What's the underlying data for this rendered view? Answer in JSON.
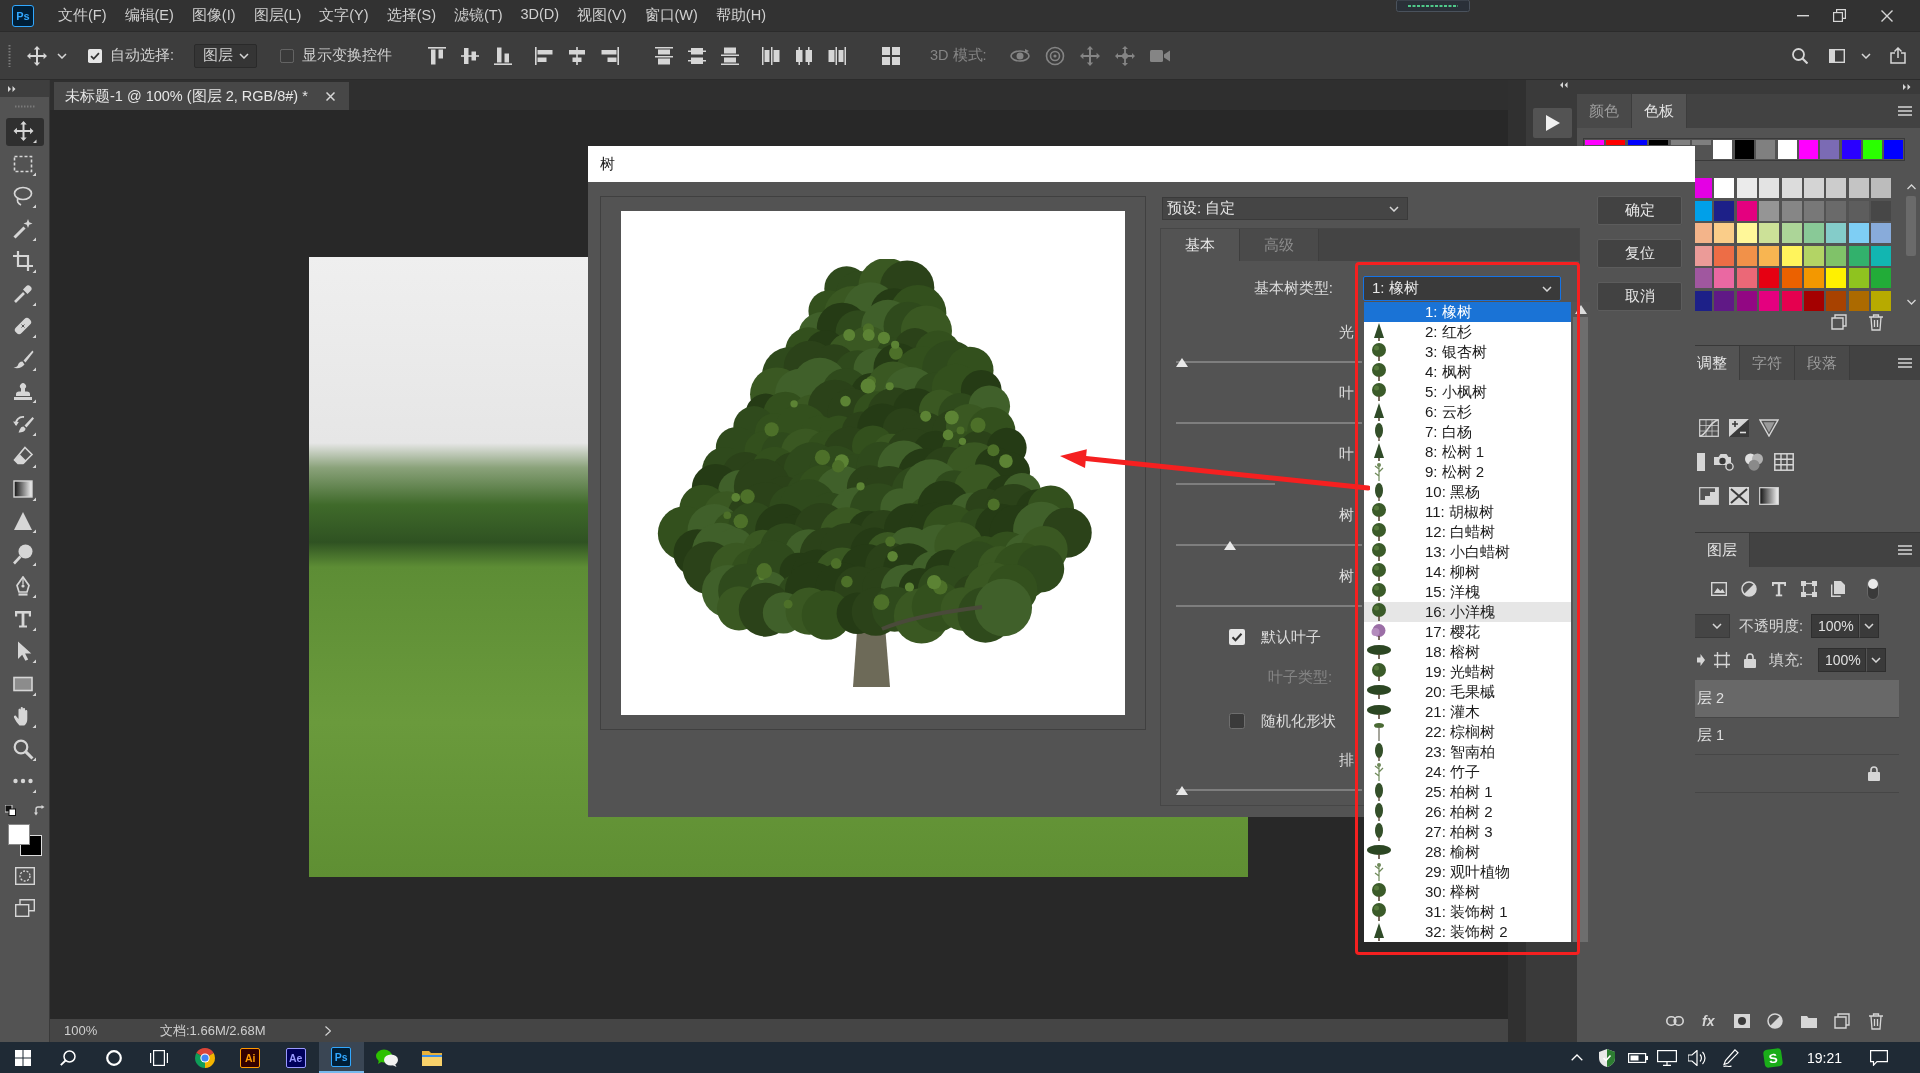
{
  "menu_bar": {
    "logo": "Ps",
    "items": [
      "文件(F)",
      "编辑(E)",
      "图像(I)",
      "图层(L)",
      "文字(Y)",
      "选择(S)",
      "滤镜(T)",
      "3D(D)",
      "视图(V)",
      "窗口(W)",
      "帮助(H)"
    ]
  },
  "options_bar": {
    "auto_select": {
      "label": "自动选择:",
      "checked": true
    },
    "target": "图层",
    "show_transform": {
      "label": "显示变换控件",
      "checked": false
    },
    "mode_3d": {
      "label": "3D 模式:",
      "disabled": true
    }
  },
  "document_tab": {
    "title": "未标题-1 @ 100% (图层 2, RGB/8#) *"
  },
  "tools": [
    {
      "kind": "move",
      "selected": true
    },
    {
      "kind": "marquee",
      "selected": false
    },
    {
      "kind": "lasso",
      "selected": false
    },
    {
      "kind": "magic_wand",
      "selected": false
    },
    {
      "kind": "crop",
      "selected": false
    },
    {
      "kind": "eyedropper",
      "selected": false
    },
    {
      "kind": "healing",
      "selected": false
    },
    {
      "kind": "brush",
      "selected": false
    },
    {
      "kind": "stamp",
      "selected": false
    },
    {
      "kind": "history_brush",
      "selected": false
    },
    {
      "kind": "eraser",
      "selected": false
    },
    {
      "kind": "gradient",
      "selected": false
    },
    {
      "kind": "blur",
      "selected": false
    },
    {
      "kind": "dodge",
      "selected": false
    },
    {
      "kind": "pen",
      "selected": false
    },
    {
      "kind": "type",
      "selected": false
    },
    {
      "kind": "path_select",
      "selected": false
    },
    {
      "kind": "rectangle",
      "selected": false
    },
    {
      "kind": "hand",
      "selected": false
    },
    {
      "kind": "zoom",
      "selected": false
    },
    {
      "kind": "more",
      "selected": false
    }
  ],
  "status_bar": {
    "zoom": "100%",
    "document": "文档:1.66M/2.68M"
  },
  "dialog": {
    "title": "树",
    "preset": "预设: 自定",
    "tabs": [
      {
        "label": "基本",
        "selected": true
      },
      {
        "label": "高级",
        "selected": false
      }
    ],
    "tree_type": {
      "label": "基本树类型:",
      "value": "1: 橡树"
    },
    "controls": [
      {
        "kind": "slider",
        "label": "光",
        "level": 0.03
      },
      {
        "kind": "slider",
        "label": "叶"
      },
      {
        "kind": "slider",
        "label": "叶"
      },
      {
        "kind": "slider",
        "label": "树",
        "level": 0.29
      },
      {
        "kind": "slider",
        "label": "树"
      },
      {
        "kind": "checkbox",
        "label": "默认叶子",
        "checked": true
      },
      {
        "kind": "label",
        "label": "叶子类型:",
        "disabled": true
      },
      {
        "kind": "checkbox",
        "label": "随机化形状",
        "checked": false
      },
      {
        "kind": "slider",
        "label": "排",
        "level": 0.03
      }
    ],
    "buttons": [
      "确定",
      "复位",
      "取消"
    ]
  },
  "tree_type_list": [
    {
      "label": "1: 橡树",
      "kind": "none",
      "selected": true,
      "hovered": false
    },
    {
      "label": "2: 红杉",
      "kind": "conifer",
      "selected": false,
      "hovered": false
    },
    {
      "label": "3: 银杏树",
      "kind": "broadleaf",
      "selected": false,
      "hovered": false
    },
    {
      "label": "4: 枫树",
      "kind": "broadleaf",
      "selected": false,
      "hovered": false
    },
    {
      "label": "5: 小枫树",
      "kind": "broadleaf",
      "selected": false,
      "hovered": false
    },
    {
      "label": "6: 云杉",
      "kind": "conifer",
      "selected": false,
      "hovered": false
    },
    {
      "label": "7: 白杨",
      "kind": "slender",
      "selected": false,
      "hovered": false
    },
    {
      "label": "8: 松树 1",
      "kind": "conifer",
      "selected": false,
      "hovered": false
    },
    {
      "label": "9: 松树 2",
      "kind": "sparse",
      "selected": false,
      "hovered": false
    },
    {
      "label": "10: 黑杨",
      "kind": "slender",
      "selected": false,
      "hovered": false
    },
    {
      "label": "11: 胡椒树",
      "kind": "broadleaf",
      "selected": false,
      "hovered": false
    },
    {
      "label": "12: 白蜡树",
      "kind": "broadleaf",
      "selected": false,
      "hovered": false
    },
    {
      "label": "13: 小白蜡树",
      "kind": "broadleaf",
      "selected": false,
      "hovered": false
    },
    {
      "label": "14: 柳树",
      "kind": "broadleaf",
      "selected": false,
      "hovered": false
    },
    {
      "label": "15: 洋槐",
      "kind": "broadleaf",
      "selected": false,
      "hovered": false
    },
    {
      "label": "16: 小洋槐",
      "kind": "broadleaf",
      "selected": false,
      "hovered": true
    },
    {
      "label": "17: 樱花",
      "kind": "blossom",
      "selected": false,
      "hovered": false
    },
    {
      "label": "18: 榕树",
      "kind": "spreading",
      "selected": false,
      "hovered": false
    },
    {
      "label": "19: 光蜡树",
      "kind": "broadleaf",
      "selected": false,
      "hovered": false
    },
    {
      "label": "20: 毛果槭",
      "kind": "spreading",
      "selected": false,
      "hovered": false
    },
    {
      "label": "21: 灌木",
      "kind": "spreading",
      "selected": false,
      "hovered": false
    },
    {
      "label": "22: 棕榈树",
      "kind": "palm",
      "selected": false,
      "hovered": false
    },
    {
      "label": "23: 智南柏",
      "kind": "slender",
      "selected": false,
      "hovered": false
    },
    {
      "label": "24: 竹子",
      "kind": "sparse",
      "selected": false,
      "hovered": false
    },
    {
      "label": "25: 柏树 1",
      "kind": "slender",
      "selected": false,
      "hovered": false
    },
    {
      "label": "26: 柏树 2",
      "kind": "slender",
      "selected": false,
      "hovered": false
    },
    {
      "label": "27: 柏树 3",
      "kind": "slender",
      "selected": false,
      "hovered": false
    },
    {
      "label": "28: 榆树",
      "kind": "spreading",
      "selected": false,
      "hovered": false
    },
    {
      "label": "29: 观叶植物",
      "kind": "sparse",
      "selected": false,
      "hovered": false
    },
    {
      "label": "30: 榉树",
      "kind": "broadleaf",
      "selected": false,
      "hovered": false
    },
    {
      "label": "31: 装饰树 1",
      "kind": "broadleaf",
      "selected": false,
      "hovered": false
    },
    {
      "label": "32: 装饰树 2",
      "kind": "conifer",
      "selected": false,
      "hovered": false
    }
  ],
  "swatches_panel": {
    "tabs": [
      {
        "label": "颜色",
        "selected": false
      },
      {
        "label": "色板",
        "selected": true
      }
    ],
    "recent": [
      {
        "color": "#ff00ff"
      },
      {
        "color": "#ff0000"
      },
      {
        "color": "#0000ff"
      },
      {
        "color": "#000000"
      },
      {
        "color": "#808080"
      },
      {
        "color": "#7f7f7f"
      },
      {
        "color": "#ffffff"
      },
      {
        "color": "#000000"
      },
      {
        "color": "#808080"
      },
      {
        "color": "#ffffff"
      },
      {
        "color": "#ff00ff"
      },
      {
        "color": "#7b6bb4"
      },
      {
        "color": "#2a00ff"
      },
      {
        "color": "#2aff00"
      },
      {
        "color": "#0000ff"
      }
    ],
    "grid": [
      {
        "color": "#e400e4"
      },
      {
        "color": "#ffffff"
      },
      {
        "color": "#ebebeb"
      },
      {
        "color": "#e3e3e3"
      },
      {
        "color": "#dcdcdc"
      },
      {
        "color": "#d4d4d4"
      },
      {
        "color": "#cccccc"
      },
      {
        "color": "#c4c4c4"
      },
      {
        "color": "#bcbcbc"
      },
      {
        "color": "#00a0e9"
      },
      {
        "color": "#1d2088"
      },
      {
        "color": "#e4007f"
      },
      {
        "color": "#959595"
      },
      {
        "color": "#868686"
      },
      {
        "color": "#787878"
      },
      {
        "color": "#6a6a6a"
      },
      {
        "color": "#5d5d5d"
      },
      {
        "color": "#474747"
      },
      {
        "color": "#f3b48a"
      },
      {
        "color": "#facd89"
      },
      {
        "color": "#fff799"
      },
      {
        "color": "#cce198"
      },
      {
        "color": "#acd598"
      },
      {
        "color": "#89c997"
      },
      {
        "color": "#84ccc9"
      },
      {
        "color": "#7ecef4"
      },
      {
        "color": "#88abda"
      },
      {
        "color": "#eb9b98"
      },
      {
        "color": "#ed6d46"
      },
      {
        "color": "#f19149"
      },
      {
        "color": "#f8b551"
      },
      {
        "color": "#fff45c"
      },
      {
        "color": "#b3d465"
      },
      {
        "color": "#80c269"
      },
      {
        "color": "#32b16c"
      },
      {
        "color": "#12b6b1"
      },
      {
        "color": "#a0579f"
      },
      {
        "color": "#ea68a2"
      },
      {
        "color": "#eb6877"
      },
      {
        "color": "#e60012"
      },
      {
        "color": "#eb6100"
      },
      {
        "color": "#f39800"
      },
      {
        "color": "#fff100"
      },
      {
        "color": "#8fc31f"
      },
      {
        "color": "#22ac38"
      },
      {
        "color": "#1d2088"
      },
      {
        "color": "#601986"
      },
      {
        "color": "#920783"
      },
      {
        "color": "#e4007f"
      },
      {
        "color": "#e5004f"
      },
      {
        "color": "#a40000"
      },
      {
        "color": "#a84200"
      },
      {
        "color": "#ac6a00"
      },
      {
        "color": "#b7aa00"
      }
    ]
  },
  "adjustments_panel": {
    "tabs": [
      {
        "label": "调整",
        "selected": true
      },
      {
        "label": "字符",
        "selected": false
      },
      {
        "label": "段落",
        "selected": false
      }
    ]
  },
  "layers_panel": {
    "tabs": [
      {
        "label": "图层",
        "selected": true
      }
    ],
    "filter_toggle": {
      "on": true
    },
    "opacity_label": "不透明度:",
    "opacity": "100%",
    "fill_label": "填充:",
    "fill": "100%",
    "layers": [
      {
        "name": "层 2",
        "selected": true,
        "locked": false
      },
      {
        "name": "层 1",
        "selected": false,
        "locked": false
      },
      {
        "selected": false,
        "locked": true
      }
    ],
    "effects_label": "fx"
  },
  "taskbar": {
    "apps": [
      {
        "kind": "chrome",
        "selected": false
      },
      {
        "kind": "illustrator",
        "label": "Ai",
        "selected": false
      },
      {
        "kind": "after_effects",
        "label": "Ae",
        "selected": false
      },
      {
        "kind": "photoshop",
        "label": "Ps",
        "selected": true
      },
      {
        "kind": "wechat",
        "selected": false
      },
      {
        "kind": "file_explorer",
        "selected": false
      }
    ],
    "tray_badge": "S",
    "time": "19:21"
  }
}
